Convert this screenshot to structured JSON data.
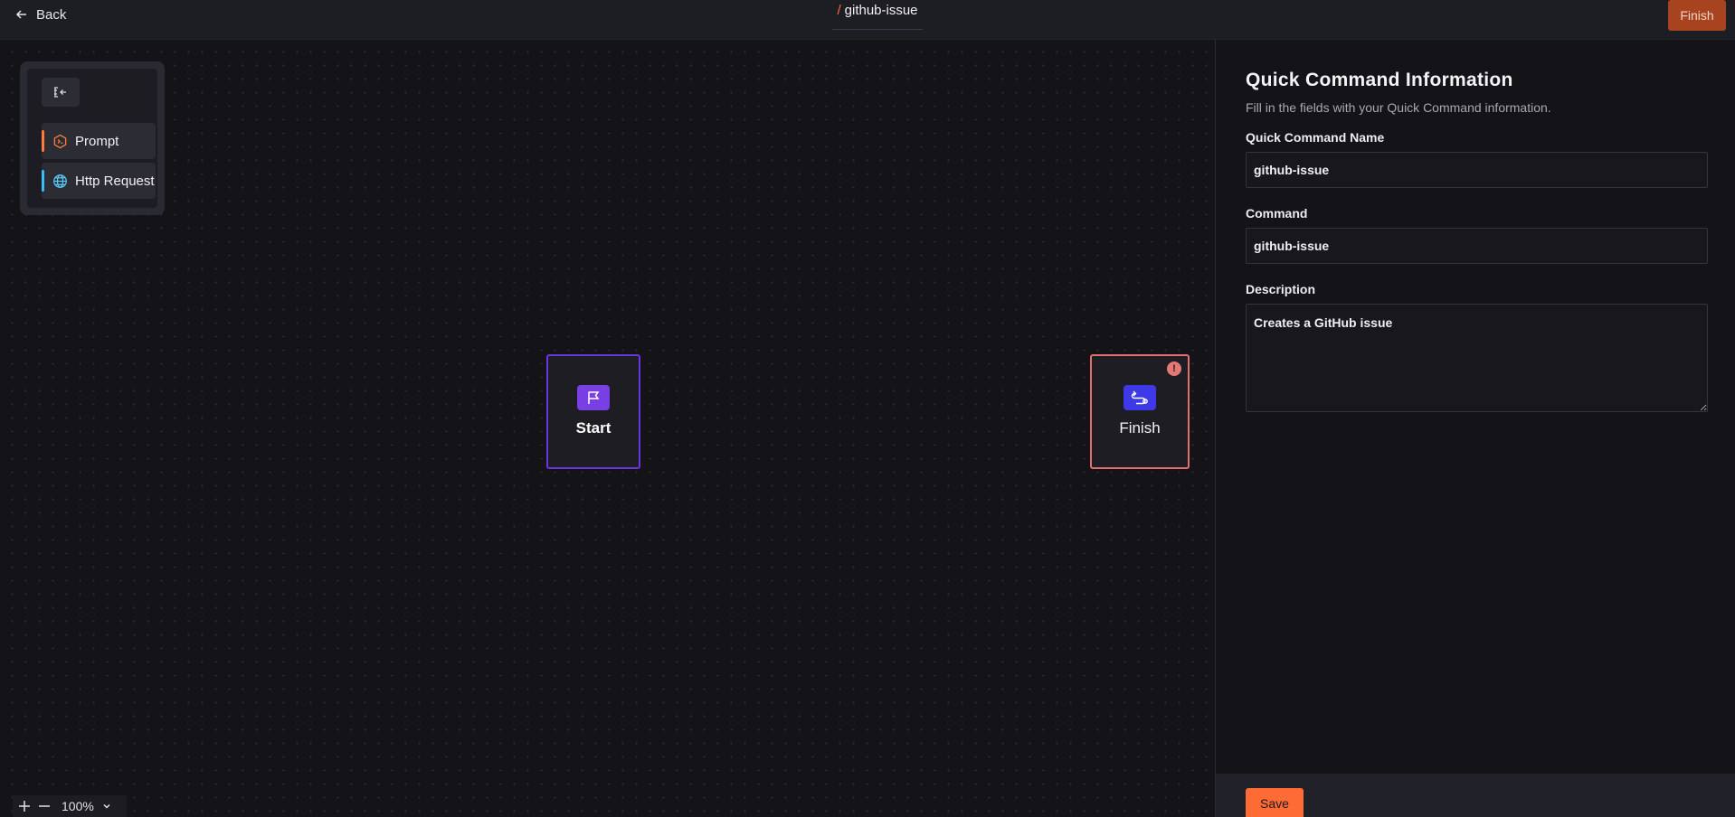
{
  "header": {
    "back_label": "Back",
    "title_prefix": "/",
    "title": "github-issue",
    "finish_label": "Finish"
  },
  "palette": {
    "items": [
      {
        "label": "Prompt",
        "icon": "prompt-hexagon-icon",
        "accent": "#ff7a3d"
      },
      {
        "label": "Http Request",
        "icon": "globe-icon",
        "accent": "#38bdf8"
      }
    ]
  },
  "nodes": {
    "start": {
      "label": "Start",
      "icon": "flag-icon",
      "color": "#7a3fe4"
    },
    "finish": {
      "label": "Finish",
      "icon": "route-icon",
      "color": "#3d39e6",
      "warning": "!"
    }
  },
  "zoom": {
    "level": "100%"
  },
  "panel": {
    "title": "Quick Command Information",
    "subtitle": "Fill in the fields with your Quick Command information.",
    "fields": {
      "name": {
        "label": "Quick Command Name",
        "value": "github-issue"
      },
      "command": {
        "label": "Command",
        "value": "github-issue"
      },
      "description": {
        "label": "Description",
        "value": "Creates a GitHub issue"
      }
    },
    "save_label": "Save"
  },
  "colors": {
    "accent": "#ff6b35",
    "error": "#e2706c"
  }
}
